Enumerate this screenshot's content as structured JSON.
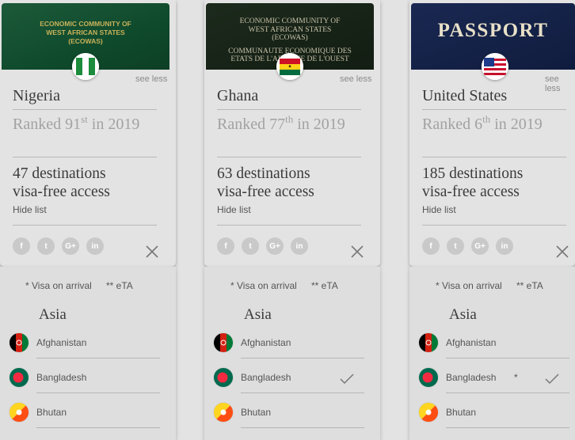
{
  "ui": {
    "see_less": "see less",
    "hide_list": "Hide list",
    "dest_line2": "visa-free access",
    "legend_visa": "* Visa on arrival",
    "legend_eta": "** eTA",
    "region": "Asia",
    "socials": [
      "f",
      "t",
      "G+",
      "in"
    ],
    "social_icons": [
      "facebook-icon",
      "twitter-icon",
      "google-plus-icon",
      "linkedin-icon"
    ]
  },
  "passports": [
    {
      "cover_lines": [
        "ECONOMIC COMMUNITY OF",
        "WEST AFRICAN STATES",
        "(ECOWAS)"
      ],
      "country": "Nigeria",
      "rank_prefix": "Ranked 91",
      "rank_suffix": "st",
      "rank_year": " in 2019",
      "destinations": "47 destinations",
      "countries": [
        {
          "name": "Afghanistan",
          "note": "",
          "check": false
        },
        {
          "name": "Bangladesh",
          "note": "",
          "check": false
        },
        {
          "name": "Bhutan",
          "note": "",
          "check": false
        }
      ]
    },
    {
      "cover_lines": [
        "ECONOMIC COMMUNITY OF",
        "WEST AFRICAN STATES",
        "(ECOWAS)",
        "COMMUNAUTE ECONOMIQUE DES",
        "ETATS DE L'AFRIQUE DE L'OUEST"
      ],
      "country": "Ghana",
      "rank_prefix": "Ranked 77",
      "rank_suffix": "th",
      "rank_year": " in 2019",
      "destinations": "63 destinations",
      "countries": [
        {
          "name": "Afghanistan",
          "note": "",
          "check": false
        },
        {
          "name": "Bangladesh",
          "note": "",
          "check": true
        },
        {
          "name": "Bhutan",
          "note": "",
          "check": false
        }
      ]
    },
    {
      "cover_lines": [
        "PASSPORT"
      ],
      "country": "United States",
      "rank_prefix": "Ranked 6",
      "rank_suffix": "th",
      "rank_year": " in 2019",
      "destinations": "185 destinations",
      "countries": [
        {
          "name": "Afghanistan",
          "note": "",
          "check": false
        },
        {
          "name": "Bangladesh",
          "note": "*",
          "check": true
        },
        {
          "name": "Bhutan",
          "note": "",
          "check": false
        }
      ]
    }
  ]
}
